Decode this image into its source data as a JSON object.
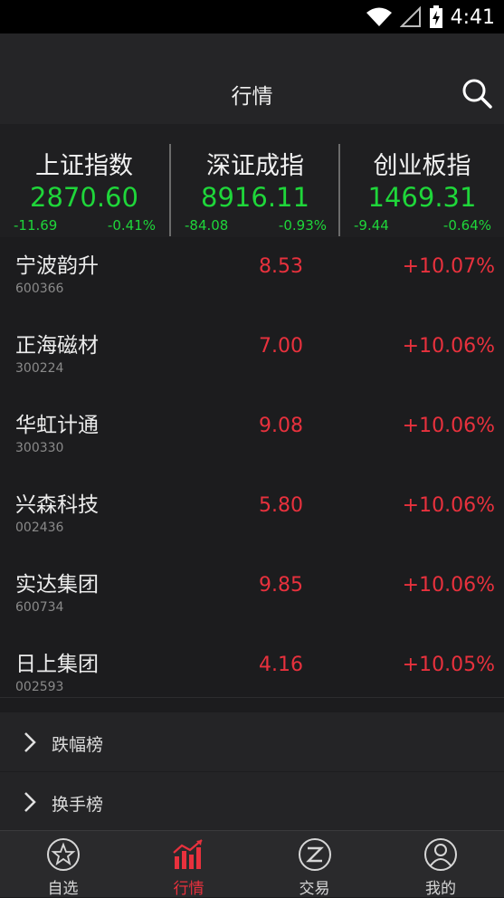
{
  "status": {
    "time": "4:41"
  },
  "header": {
    "title": "行情"
  },
  "indices": [
    {
      "name": "上证指数",
      "value": "2870.60",
      "change": "-11.69",
      "pct": "-0.41%"
    },
    {
      "name": "深证成指",
      "value": "8916.11",
      "change": "-84.08",
      "pct": "-0.93%"
    },
    {
      "name": "创业板指",
      "value": "1469.31",
      "change": "-9.44",
      "pct": "-0.64%"
    }
  ],
  "stocks": [
    {
      "name": "宁波韵升",
      "code": "600366",
      "price": "8.53",
      "pct": "+10.07%"
    },
    {
      "name": "正海磁材",
      "code": "300224",
      "price": "7.00",
      "pct": "+10.06%"
    },
    {
      "name": "华虹计通",
      "code": "300330",
      "price": "9.08",
      "pct": "+10.06%"
    },
    {
      "name": "兴森科技",
      "code": "002436",
      "price": "5.80",
      "pct": "+10.06%"
    },
    {
      "name": "实达集团",
      "code": "600734",
      "price": "9.85",
      "pct": "+10.06%"
    },
    {
      "name": "日上集团",
      "code": "002593",
      "price": "4.16",
      "pct": "+10.05%"
    }
  ],
  "sections": [
    {
      "label": "跌幅榜"
    },
    {
      "label": "换手榜"
    }
  ],
  "tabs": [
    {
      "label": "自选",
      "icon": "star-icon"
    },
    {
      "label": "行情",
      "icon": "chart-icon"
    },
    {
      "label": "交易",
      "icon": "trade-icon"
    },
    {
      "label": "我的",
      "icon": "user-icon"
    }
  ],
  "colors": {
    "up": "#e8313d",
    "down": "#1fd63a",
    "active_tab": "#e8313d"
  }
}
